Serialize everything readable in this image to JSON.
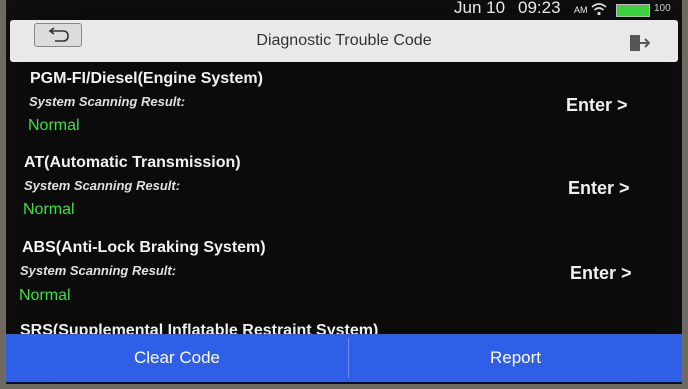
{
  "status_bar": {
    "date": "Jun 10",
    "time": "09:23",
    "ampm": "AM",
    "battery": "100",
    "battery_color": "#3bd23b"
  },
  "header": {
    "title": "Diagnostic Trouble Code",
    "back_icon": "back-icon",
    "exit_icon": "exit-icon"
  },
  "systems": [
    {
      "name": "PGM-FI/Diesel(Engine System)",
      "result_label": "System Scanning Result:",
      "status": "Normal",
      "action": "Enter >"
    },
    {
      "name": "AT(Automatic Transmission)",
      "result_label": "System Scanning Result:",
      "status": "Normal",
      "action": "Enter >"
    },
    {
      "name": "ABS(Anti-Lock Braking System)",
      "result_label": "System Scanning Result:",
      "status": "Normal",
      "action": "Enter >"
    },
    {
      "name": "SRS(Supplemental Inflatable Restraint System)"
    }
  ],
  "footer": {
    "clear_label": "Clear Code",
    "report_label": "Report",
    "bar_color": "#2f5fe6"
  },
  "colors": {
    "status_normal": "#39e23d",
    "screen_bg": "#0b0b0c"
  }
}
